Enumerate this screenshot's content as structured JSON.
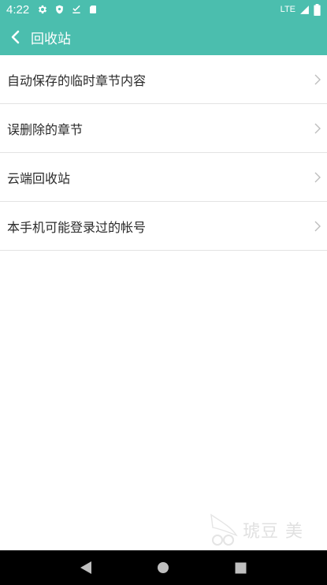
{
  "status_bar": {
    "time": "4:22",
    "network": "LTE",
    "icons_left": [
      "gear-icon",
      "shield-icon",
      "download-done-icon",
      "sd-card-icon"
    ],
    "icons_right": [
      "signal-icon",
      "battery-icon"
    ]
  },
  "app_bar": {
    "title": "回收站",
    "color": "#4bbeae"
  },
  "list": {
    "items": [
      {
        "label": "自动保存的临时章节内容"
      },
      {
        "label": "误删除的章节"
      },
      {
        "label": "云端回收站"
      },
      {
        "label": "本手机可能登录过的帐号"
      }
    ]
  },
  "watermark": {
    "text": "琥豆 美"
  },
  "nav_bar": {
    "buttons": [
      "back-triangle-icon",
      "home-circle-icon",
      "recents-square-icon"
    ]
  }
}
